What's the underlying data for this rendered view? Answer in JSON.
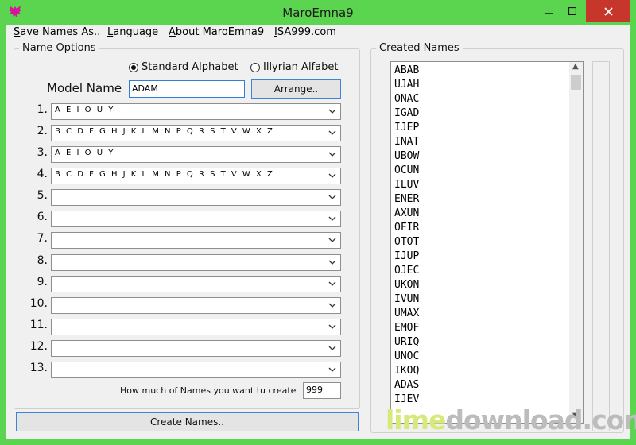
{
  "window": {
    "title": "MaroEmna9"
  },
  "menu": {
    "save": {
      "u": "S",
      "rest": "ave Names As.."
    },
    "language": {
      "u": "L",
      "rest": "anguage"
    },
    "about": {
      "u": "A",
      "rest": "bout MaroEmna9"
    },
    "site": {
      "u": "I",
      "rest": "SA999.com"
    }
  },
  "name_options": {
    "title": "Name Options",
    "radio_standard": "Standard Alphabet",
    "radio_illyrian": "Illyrian Alfabet",
    "model_label": "Model Name",
    "model_value": "ADAM",
    "arrange_button": "Arrange..",
    "rows": [
      {
        "label": "1.",
        "value": "A E I O U Y"
      },
      {
        "label": "2.",
        "value": "B C D F G H J K L M N P Q R S T V W X Z"
      },
      {
        "label": "3.",
        "value": "A E I O U Y"
      },
      {
        "label": "4.",
        "value": "B C D F G H J K L M N P Q R S T V W X Z"
      },
      {
        "label": "5.",
        "value": ""
      },
      {
        "label": "6.",
        "value": ""
      },
      {
        "label": "7.",
        "value": ""
      },
      {
        "label": "8.",
        "value": ""
      },
      {
        "label": "9.",
        "value": ""
      },
      {
        "label": "10.",
        "value": ""
      },
      {
        "label": "11.",
        "value": ""
      },
      {
        "label": "12.",
        "value": ""
      },
      {
        "label": "13.",
        "value": ""
      }
    ],
    "count_label": "How much of Names you want tu create",
    "count_value": "999"
  },
  "create_button": "Create Names..",
  "created_names": {
    "title": "Created Names",
    "items": [
      "ABAB",
      "UJAH",
      "ONAC",
      "IGAD",
      "IJEP",
      "INAT",
      "UBOW",
      "OCUN",
      "ILUV",
      "ENER",
      "AXUN",
      "OFIR",
      "OTOT",
      "IJUP",
      "OJEC",
      "UKON",
      "IVUN",
      "UMAX",
      "EMOF",
      "URIQ",
      "UNOC",
      "IKOQ",
      "ADAS",
      "IJEV"
    ]
  },
  "watermark": {
    "part1": "lime",
    "part2": "download.com"
  }
}
